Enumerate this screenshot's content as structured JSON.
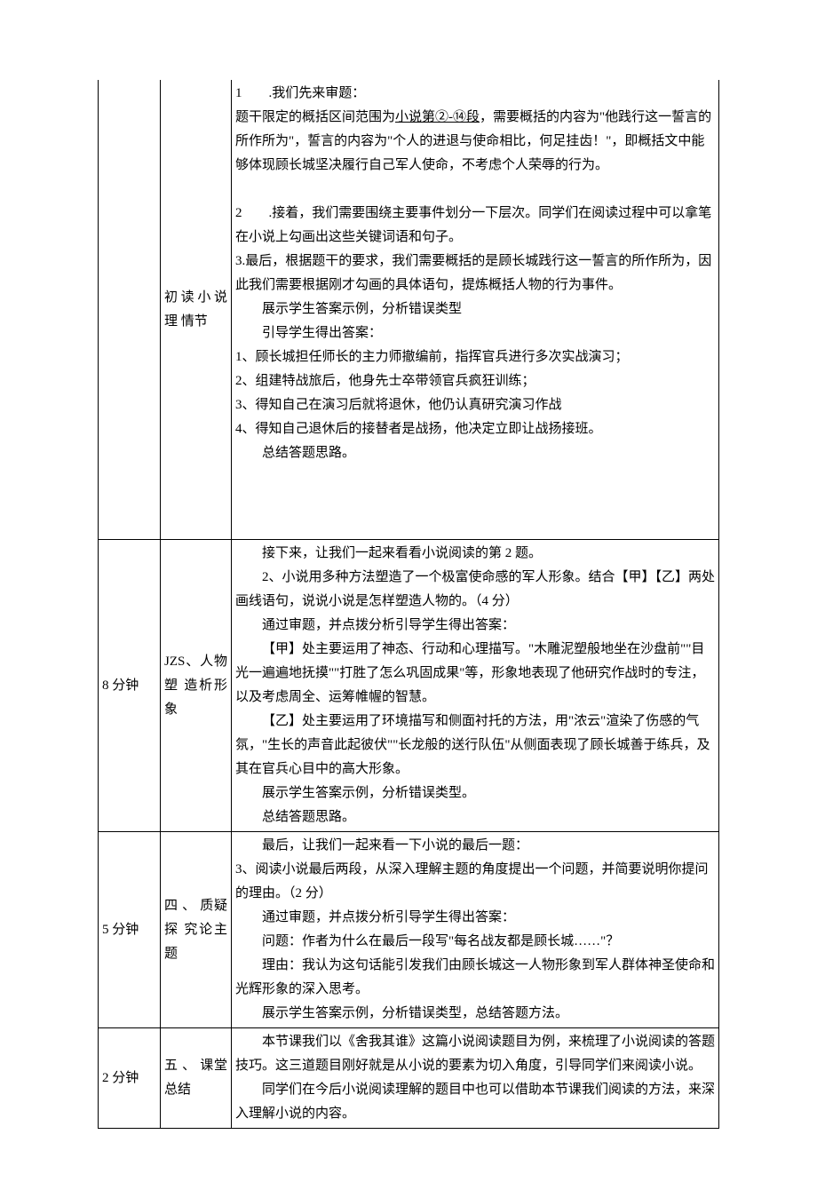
{
  "rows": [
    {
      "time": "",
      "label": "初读小说 理 情节",
      "content": {
        "p1_a": "1　　.我们先来审题：",
        "p1_b_pre": "题干限定的概括区间范围为",
        "p1_b_u": "小说第②-⑭段",
        "p1_b_post": "，需要概括的内容为\"他践行这一誓言的所作所为\"，誓言的内容为\"个人的进退与使命相比，何足挂齿！\"，即概括文中能够体现顾长城坚决履行自己军人使命，不考虑个人荣辱的行为。",
        "p2": "2　　.接着，我们需要围绕主要事件划分一下层次。同学们在阅读过程中可以拿笔在小说上勾画出这些关键词语和句子。",
        "p3": "3.最后，根据题干的要求，我们需要概括的是顾长城践行这一誓言的所作所为，因此我们需要根据刚才勾画的具体语句，提炼概括人物的行为事件。",
        "p4": "展示学生答案示例，分析错误类型",
        "p5": "引导学生得出答案：",
        "l1": "1、顾长城担任师长的主力师撤编前，指挥官兵进行多次实战演习；",
        "l2": "2、组建特战旅后，他身先士卒带领官兵疯狂训练；",
        "l3": "3、得知自己在演习后就将退休，他仍认真研究演习作战",
        "l4": "4、得知自己退休后的接替者是战扬，他决定立即让战扬接班。",
        "p6": "总结答题思路。"
      }
    },
    {
      "time": "8 分钟",
      "label": "JZS、人物 塑 造析形象",
      "content": {
        "p1": "接下来，让我们一起来看看小说阅读的第 2 题。",
        "p2": "2、小说用多种方法塑造了一个极富使命感的军人形象。结合【甲】【乙】两处画线语句，说说小说是怎样塑造人物的。（4 分）",
        "p3": "通过审题，并点拨分析引导学生得出答案：",
        "p4": "【甲】处主要运用了神态、行动和心理描写。\"木雕泥塑般地坐在沙盘前\"\"目光一遍遍地抚摸\"\"打胜了怎么巩固成果\"等，形象地表现了他研究作战时的专注，以及考虑周全、运筹帷幄的智慧。",
        "p5": "【乙】处主要运用了环境描写和侧面衬托的方法，用\"浓云\"渲染了伤感的气氛，\"生长的声音此起彼伏\"\"长龙般的送行队伍\"从侧面表现了顾长城善于练兵，及其在官兵心目中的高大形象。",
        "p6": "展示学生答案示例，分析错误类型。",
        "p7": "总结答题思路。"
      }
    },
    {
      "time": "5 分钟",
      "label": "四 、 质疑 探 究论主题",
      "content": {
        "p1": "最后，让我们一起来看一下小说的最后一题：",
        "p2": "3、阅读小说最后两段，从深入理解主题的角度提出一个问题，并简要说明你提问的理由。（2 分）",
        "p3": "通过审题，并点拨分析引导学生得出答案：",
        "p4": "问题：作者为什么在最后一段写\"每名战友都是顾长城……\"？",
        "p5": "理由：我认为这句话能引发我们由顾长城这一人物形象到军人群体神圣使命和光辉形象的深入思考。",
        "p6": "展示学生答案示例，分析错误类型，总结答题方法。"
      }
    },
    {
      "time": "2 分钟",
      "label": "五 、 课堂总结",
      "content": {
        "p1": "本节课我们以《舍我其谁》这篇小说阅读题目为例，来梳理了小说阅读的答题技巧。这三道题目刚好就是从小说的要素为切入角度，引导同学们来阅读小说。",
        "p2": "同学们在今后小说阅读理解的题目中也可以借助本节课我们阅读的方法，来深入理解小说的内容。"
      }
    }
  ]
}
